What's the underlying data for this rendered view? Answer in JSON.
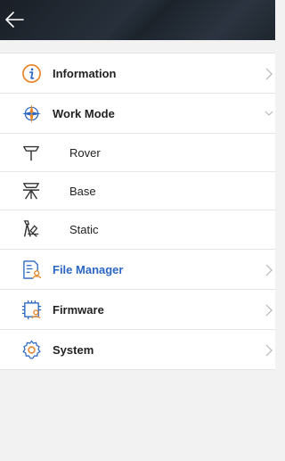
{
  "header": {
    "back_icon": "arrow-left-icon"
  },
  "menu": {
    "information": {
      "label": "Information",
      "icon": "info-circle-icon"
    },
    "work_mode": {
      "label": "Work Mode",
      "icon": "compass-icon",
      "expanded": true,
      "items": [
        {
          "label": "Rover",
          "icon": "rover-antenna-icon"
        },
        {
          "label": "Base",
          "icon": "base-tripod-icon"
        },
        {
          "label": "Static",
          "icon": "static-survey-icon"
        }
      ]
    },
    "file_manager": {
      "label": "File Manager",
      "icon": "file-manager-icon",
      "selected": true
    },
    "firmware": {
      "label": "Firmware",
      "icon": "firmware-chip-icon"
    },
    "system": {
      "label": "System",
      "icon": "gear-icon"
    }
  },
  "colors": {
    "accent": "#2b67c2",
    "icon_orange": "#e8862a",
    "header_bg": "#1f262e",
    "page_bg": "#f2f2f2"
  }
}
